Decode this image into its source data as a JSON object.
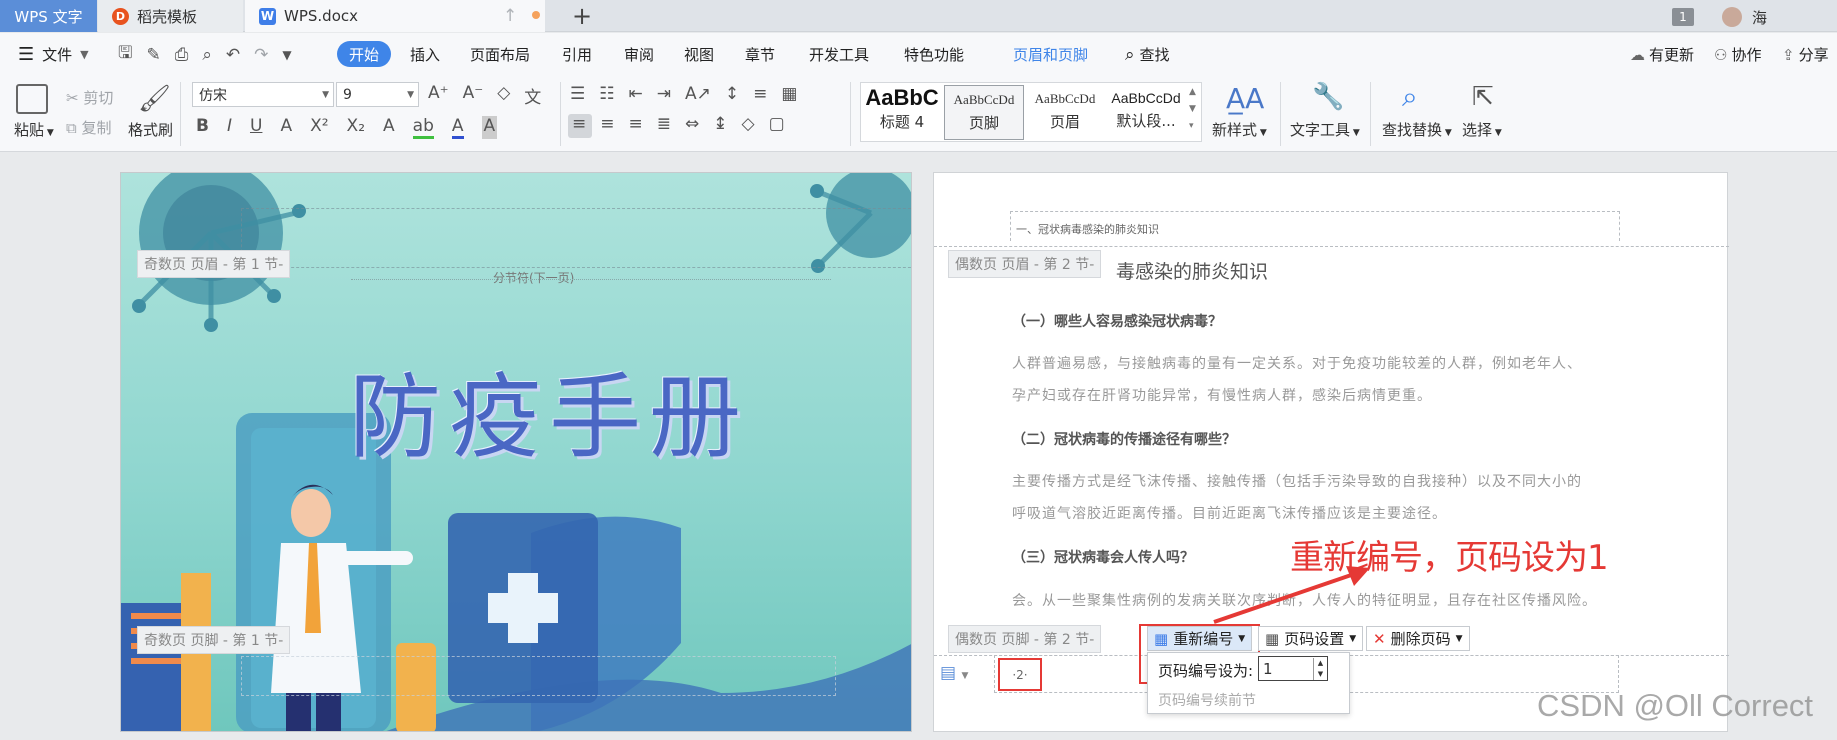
{
  "tabs": {
    "app_label": "WPS 文字",
    "template_label": "稻壳模板",
    "doc_label": "WPS.docx",
    "new_tab_symbol": "+",
    "badge_count": "1",
    "user_name": "海"
  },
  "menu": {
    "file": "文件",
    "items": [
      "开始",
      "插入",
      "页面布局",
      "引用",
      "审阅",
      "视图",
      "章节",
      "开发工具",
      "特色功能"
    ],
    "context_tab": "页眉和页脚",
    "search": "查找",
    "update": "有更新",
    "collab": "协作",
    "share": "分享"
  },
  "ribbon": {
    "paste": "粘贴",
    "cut": "剪切",
    "copy": "复制",
    "format_painter": "格式刷",
    "font_name": "仿宋",
    "font_size": "9",
    "styles": [
      {
        "preview": "AaBbC",
        "name": "标题 4"
      },
      {
        "preview": "AaBbCcDd",
        "name": "页脚"
      },
      {
        "preview": "AaBbCcDd",
        "name": "页眉"
      },
      {
        "preview": "AaBbCcDd",
        "name": "默认段..."
      }
    ],
    "new_style": "新样式",
    "text_tools": "文字工具",
    "find_replace": "查找替换",
    "select": "选择"
  },
  "left_page": {
    "header_tag": "奇数页 页眉  - 第 1 节-",
    "section_break": "分节符(下一页)",
    "title": "防疫手册",
    "footer_tag": "奇数页 页脚  - 第 1 节-"
  },
  "right_page": {
    "running_header": "一、冠状病毒感染的肺炎知识",
    "header_tag": "偶数页 页眉  - 第 2 节-",
    "section_title": "毒感染的肺炎知识",
    "q1": "（一）哪些人容易感染冠状病毒？",
    "p1a": "人群普遍易感，与接触病毒的量有一定关系。对于免疫功能较差的人群，例如老年人、",
    "p1b": "孕产妇或存在肝肾功能异常，有慢性病人群，感染后病情更重。",
    "q2": "（二）冠状病毒的传播途径有哪些？",
    "p2a": "主要传播方式是经飞沫传播、接触传播（包括手污染导致的自我接种）以及不同大小的",
    "p2b": "呼吸道气溶胶近距离传播。目前近距离飞沫传播应该是主要途径。",
    "q3": "（三）冠状病毒会人传人吗？",
    "p3": "会。从一些聚集性病例的发病关联次序判断，人传人的特征明显，且存在社区传播风险。",
    "footer_tag": "偶数页 页脚  - 第 2 节-",
    "page_number_field": "·2·"
  },
  "footer_toolbar": {
    "renumber": "重新编号",
    "page_setting": "页码设置",
    "delete_page_number": "删除页码",
    "set_label": "页码编号设为:",
    "set_value": "1",
    "continue_prev": "页码编号续前节"
  },
  "annotation": "重新编号，页码设为1",
  "watermark": "CSDN @Oll Correct",
  "colors": {
    "accent": "#3f85e8",
    "annotation_red": "#e53935",
    "cover_title": "#4a67c4"
  }
}
